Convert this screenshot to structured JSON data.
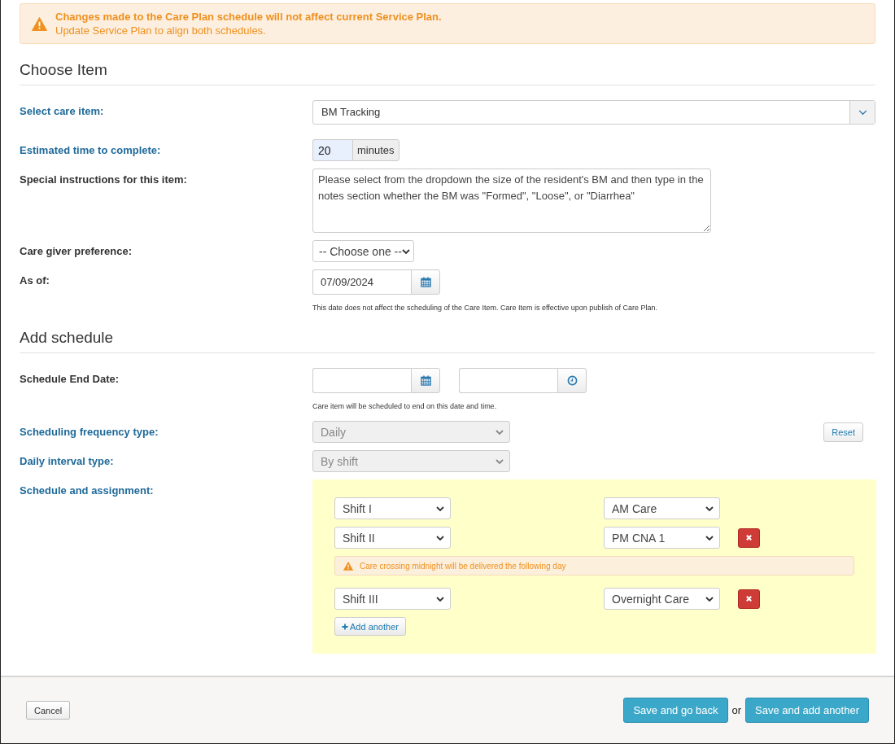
{
  "alert": {
    "title": "Changes made to the Care Plan schedule will not affect current Service Plan.",
    "text": "Update Service Plan to align both schedules."
  },
  "sections": [
    {
      "heading": "Choose Item",
      "fields": [
        {
          "kind": "combo",
          "label": "Select care item:",
          "required": true,
          "value": "BM Tracking"
        },
        {
          "kind": "duration",
          "label": "Estimated time to complete:",
          "required": true,
          "value": "20",
          "unit": "minutes"
        },
        {
          "kind": "textarea",
          "label": "Special instructions for this item:",
          "required": false,
          "value": "Please select from the dropdown the size of the resident's BM and then type in the notes section whether the BM was \"Formed\", \"Loose\", or \"Diarrhea\""
        },
        {
          "kind": "select",
          "label": "Care giver preference:",
          "required": false,
          "value": "-- Choose one --",
          "disabled": false
        },
        {
          "kind": "date",
          "label": "As of:",
          "required": false,
          "value": "07/09/2024",
          "help": "This date does not affect the scheduling of the Care Item. Care Item is effective upon publish of Care Plan."
        }
      ]
    },
    {
      "heading": "Add schedule",
      "fields": [
        {
          "kind": "datetime",
          "label": "Schedule End Date:",
          "required": false,
          "help": "Care item will be scheduled to end on this date and time."
        },
        {
          "kind": "select",
          "label": "Scheduling frequency type:",
          "required": true,
          "value": "Daily",
          "disabled": true,
          "action": "Reset"
        },
        {
          "kind": "select",
          "label": "Daily interval type:",
          "required": true,
          "value": "By shift",
          "disabled": true
        },
        {
          "kind": "schedule",
          "label": "Schedule and assignment:",
          "required": true,
          "add_button": "Add another",
          "rows": [
            {
              "kind": "shift",
              "shift": "Shift I",
              "assignment": "AM Care",
              "removable": false
            },
            {
              "kind": "shift",
              "shift": "Shift II",
              "assignment": "PM CNA 1",
              "removable": true
            },
            {
              "kind": "warning",
              "text": "Care crossing midnight will be delivered the following day"
            },
            {
              "kind": "shift",
              "shift": "Shift III",
              "assignment": "Overnight Care",
              "removable": true
            }
          ]
        }
      ]
    }
  ],
  "footer": {
    "cancel": "Cancel",
    "save_back": "Save and go back",
    "or": "or",
    "save_add": "Save and add another"
  }
}
